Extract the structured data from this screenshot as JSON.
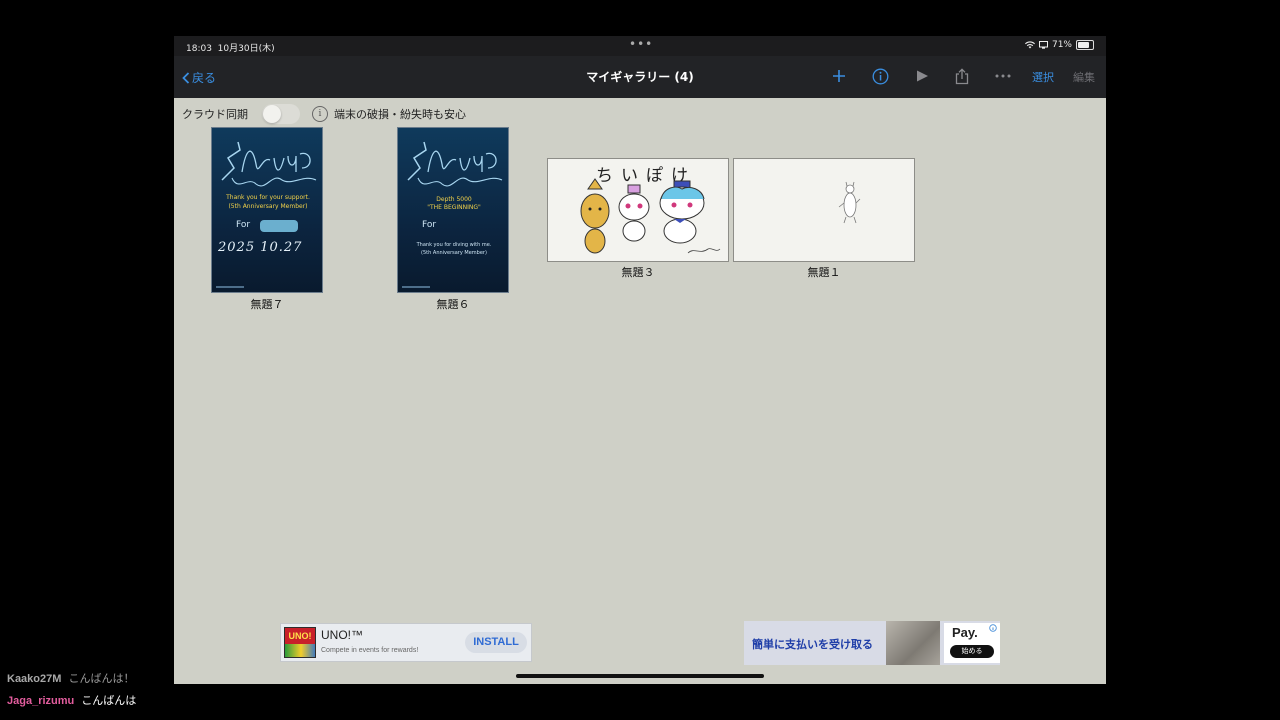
{
  "status": {
    "time": "18:03",
    "date": "10月30日(木)",
    "dots": "•••",
    "battery": "71%"
  },
  "nav": {
    "back_label": "戻る",
    "title": "マイギャラリー (4)",
    "select_label": "選択",
    "edit_label": "編集"
  },
  "cloud": {
    "label": "クラウド同期",
    "toggle_on": false,
    "notice": "端末の破損・紛失時も安心"
  },
  "gallery": {
    "items": [
      {
        "title": "無題７",
        "card": {
          "line1": "Thank you for your support.",
          "line2": "(5th Anniversary Member)",
          "for": "For",
          "date": "2025 10.27",
          "signature": "Tuna Aqua"
        }
      },
      {
        "title": "無題６",
        "card": {
          "line1": "Depth 5000",
          "line2": "\"THE BEGINNING\"",
          "for": "For",
          "line3": "Thank you for diving with me.",
          "line4": "(5th Anniversary Member)",
          "signature": "Tuna Aqua"
        }
      },
      {
        "title": "無題３",
        "drawing": {
          "heading": "ちいぽけ"
        }
      },
      {
        "title": "無題１"
      }
    ]
  },
  "ads": {
    "uno": {
      "logo": "UNO!",
      "title": "UNO!™",
      "subtitle": "Compete in events for rewards!",
      "install": "INSTALL"
    },
    "paypay": {
      "headline": "簡単に支払いを受け取る",
      "brand": "Pay.",
      "cta": "始める"
    }
  },
  "chat": [
    {
      "user": "Kaako27M",
      "message": "こんばんは！",
      "user_color": "#a8a8a8"
    },
    {
      "user": "Jaga_rizumu",
      "message": "こんばんは",
      "user_color": "#e35d9e"
    }
  ],
  "colors": {
    "accent": "#3a8ee0",
    "background": "#cfd0c7",
    "navbar": "#222326"
  }
}
